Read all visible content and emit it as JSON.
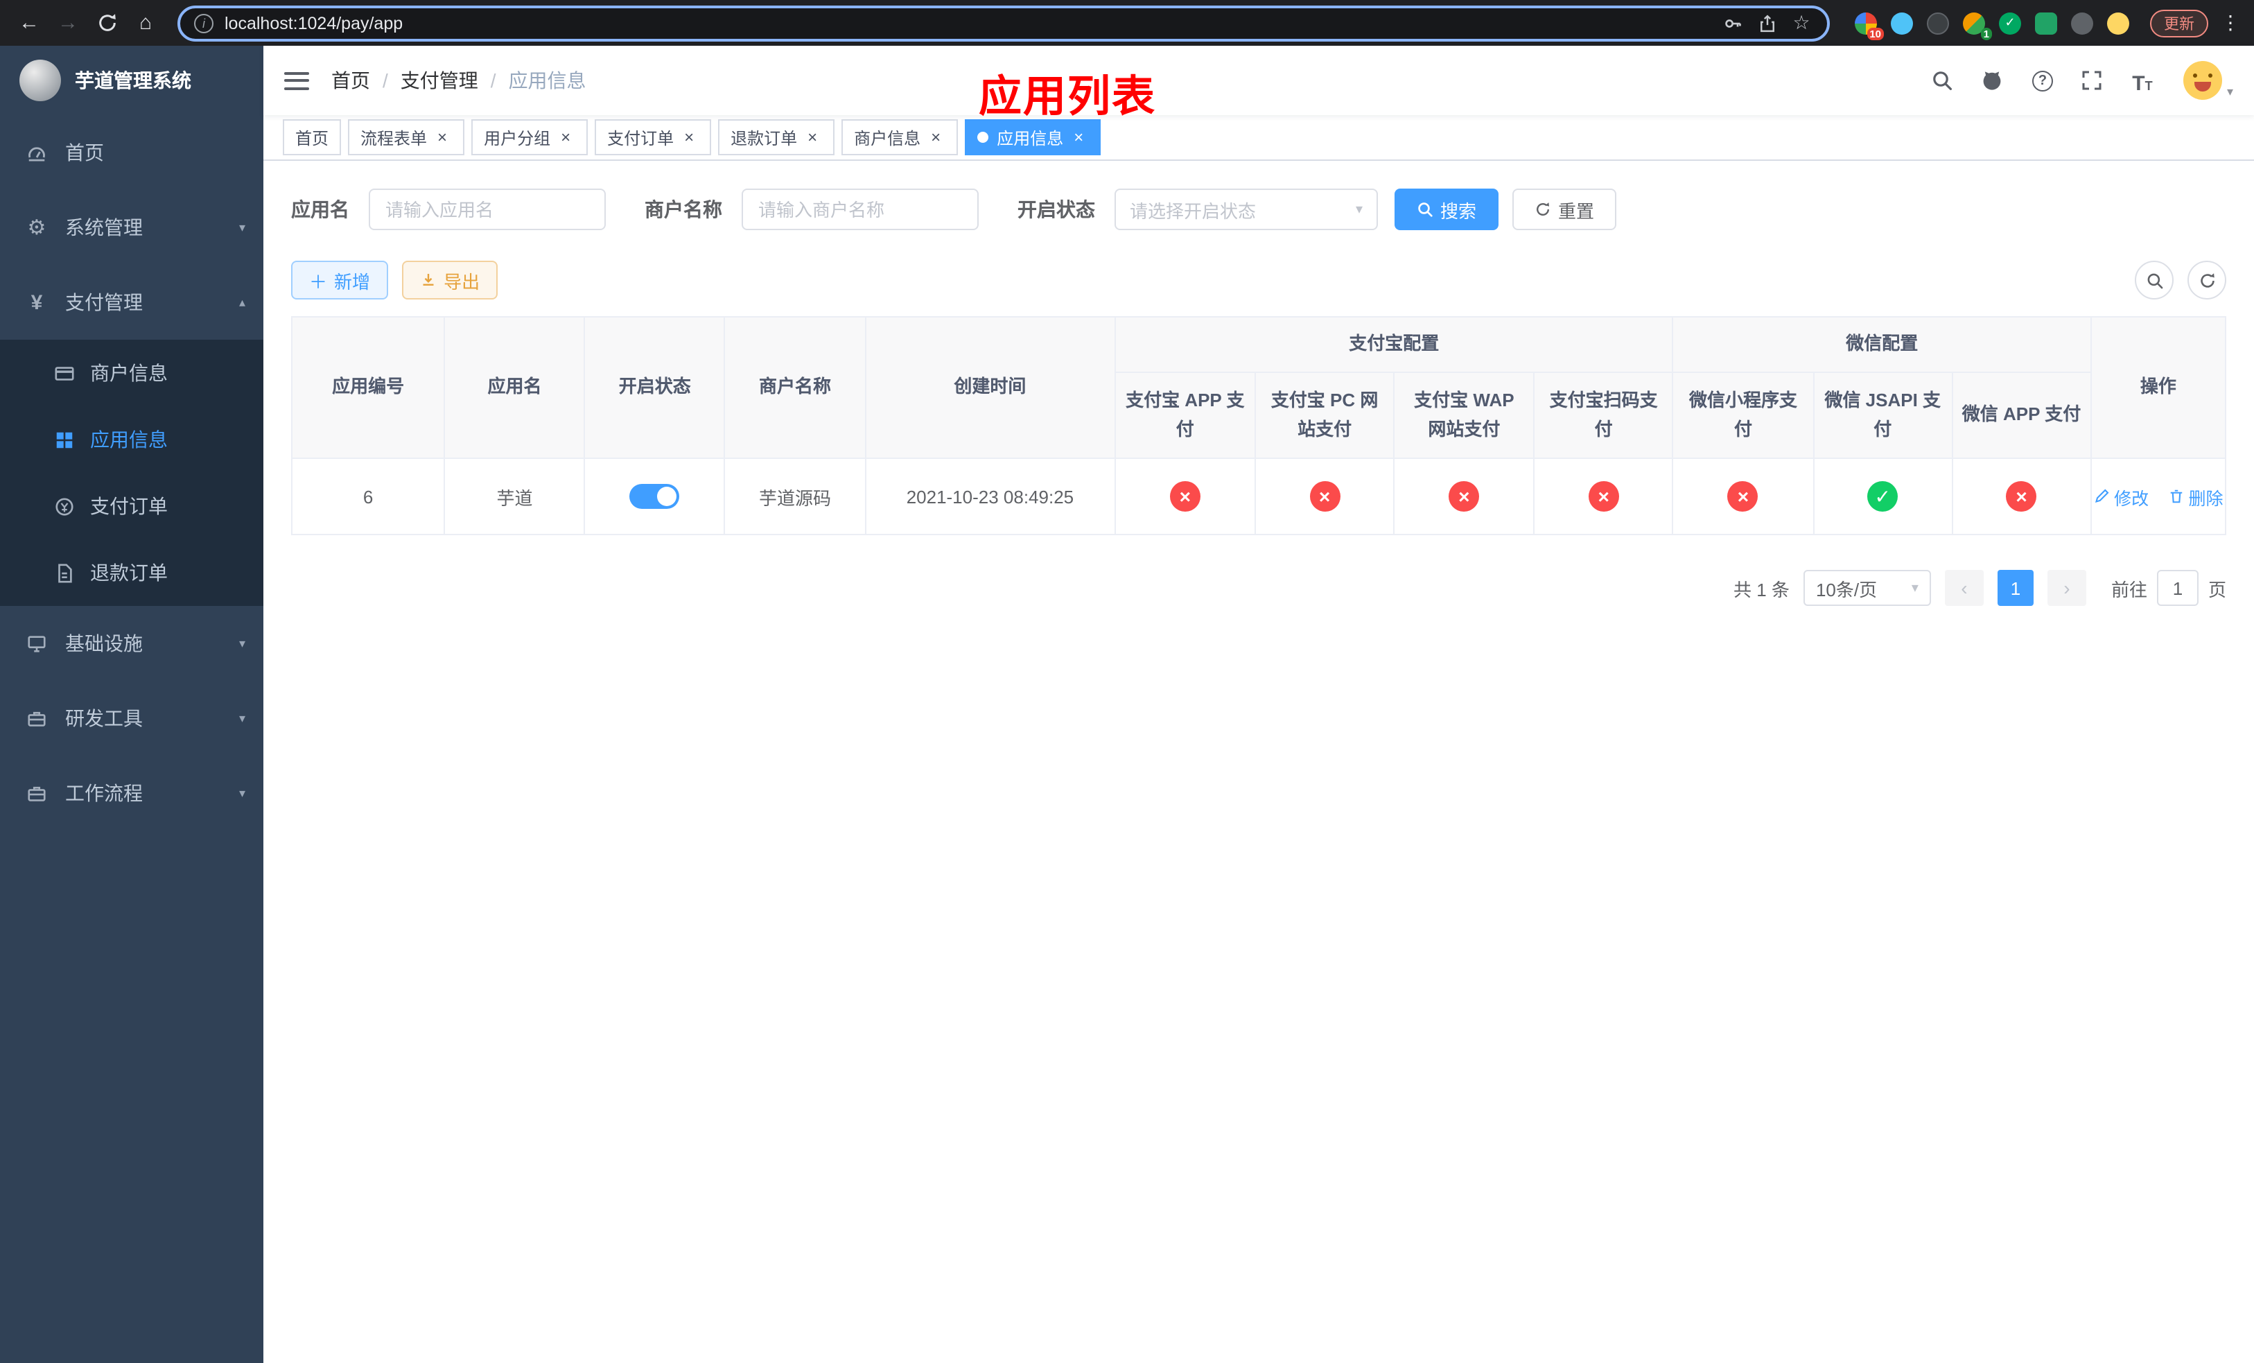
{
  "browser": {
    "url": "localhost:1024/pay/app",
    "update_button": "更新",
    "extension_badges": {
      "grid": "10",
      "avatar": "1"
    }
  },
  "sidebar": {
    "logo_title": "芋道管理系统",
    "items": [
      {
        "label": "首页"
      },
      {
        "label": "系统管理"
      },
      {
        "label": "支付管理"
      },
      {
        "label": "基础设施"
      },
      {
        "label": "研发工具"
      },
      {
        "label": "工作流程"
      }
    ],
    "payment_submenu": [
      {
        "label": "商户信息"
      },
      {
        "label": "应用信息"
      },
      {
        "label": "支付订单"
      },
      {
        "label": "退款订单"
      }
    ]
  },
  "navbar": {
    "breadcrumb": [
      "首页",
      "支付管理",
      "应用信息"
    ],
    "annotation_title": "应用列表"
  },
  "tabs": [
    {
      "label": "首页"
    },
    {
      "label": "流程表单"
    },
    {
      "label": "用户分组"
    },
    {
      "label": "支付订单"
    },
    {
      "label": "退款订单"
    },
    {
      "label": "商户信息"
    },
    {
      "label": "应用信息"
    }
  ],
  "filters": {
    "app_name": {
      "label": "应用名",
      "placeholder": "请输入应用名",
      "value": ""
    },
    "merchant_name": {
      "label": "商户名称",
      "placeholder": "请输入商户名称",
      "value": ""
    },
    "status": {
      "label": "开启状态",
      "placeholder": "请选择开启状态",
      "value": ""
    },
    "search_button": "搜索",
    "reset_button": "重置"
  },
  "toolbar": {
    "add_button": "新增",
    "export_button": "导出"
  },
  "table": {
    "group_headers": {
      "alipay": "支付宝配置",
      "wechat": "微信配置"
    },
    "columns": [
      "应用编号",
      "应用名",
      "开启状态",
      "商户名称",
      "创建时间",
      "操作"
    ],
    "channel_columns": [
      "支付宝 APP 支付",
      "支付宝 PC 网站支付",
      "支付宝 WAP 网站支付",
      "支付宝扫码支付",
      "微信小程序支付",
      "微信 JSAPI 支付",
      "微信 APP 支付"
    ],
    "rows": [
      {
        "id": "6",
        "name": "芋道",
        "enabled": true,
        "merchant": "芋道源码",
        "created_at": "2021-10-23 08:49:25",
        "channels": [
          "no",
          "no",
          "no",
          "no",
          "no",
          "yes",
          "no"
        ],
        "edit_label": "修改",
        "delete_label": "删除"
      }
    ]
  },
  "pagination": {
    "total": "共 1 条",
    "page_size": "10条/页",
    "page": "1",
    "goto_prefix": "前往",
    "goto_value": "1",
    "goto_suffix": "页"
  }
}
